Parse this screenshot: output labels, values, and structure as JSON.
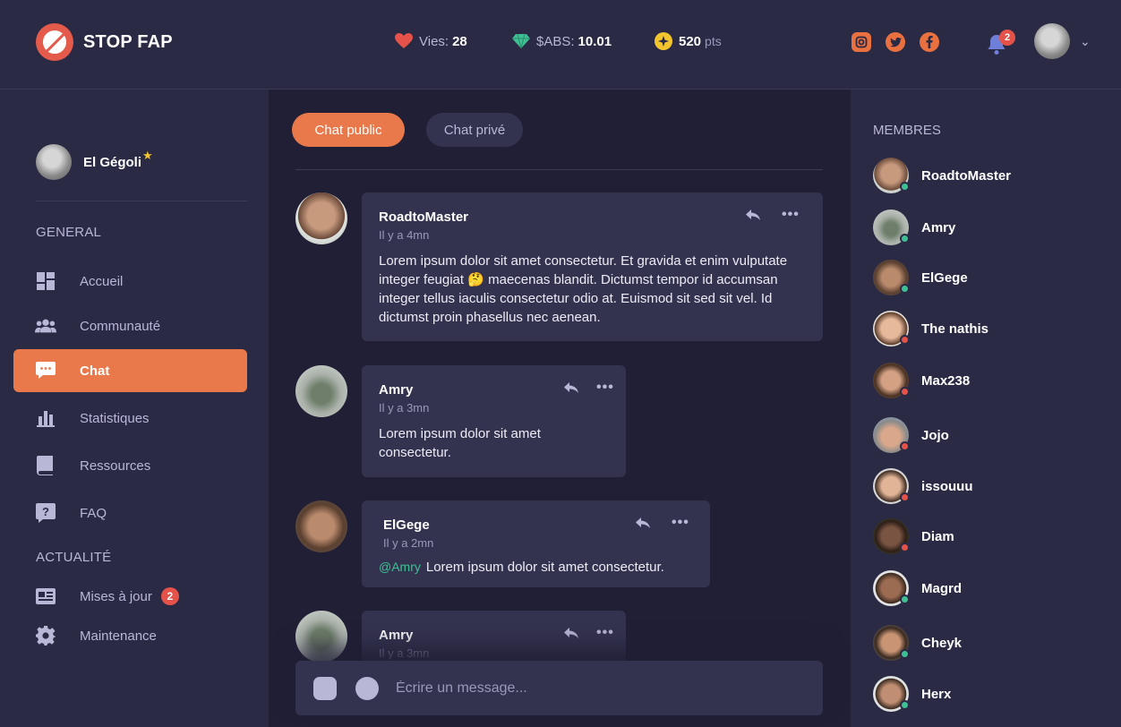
{
  "header": {
    "app_name": "STOP FAP",
    "lives_label": "Vies:",
    "lives_value": "28",
    "abs_label": "$ABS:",
    "abs_value": "10.01",
    "points_value": "520",
    "points_unit": "pts",
    "notifications_count": "2",
    "social": [
      "instagram-icon",
      "twitter-icon",
      "facebook-icon"
    ],
    "colors": {
      "accent": "#e9784a",
      "heart": "#e4524a",
      "gem": "#3fbf94",
      "coin": "#f2c52e"
    }
  },
  "sidebar": {
    "user_name": "El Gégoli",
    "section_general": "GENERAL",
    "section_news": "ACTUALITÉ",
    "items": [
      {
        "label": "Accueil",
        "icon": "dashboard-icon"
      },
      {
        "label": "Communauté",
        "icon": "users-icon"
      },
      {
        "label": "Chat",
        "icon": "chat-icon"
      },
      {
        "label": "Statistiques",
        "icon": "bar-chart-icon"
      },
      {
        "label": "Ressources",
        "icon": "book-icon"
      },
      {
        "label": "FAQ",
        "icon": "question-icon"
      }
    ],
    "news_items": [
      {
        "label": "Mises à jour",
        "badge": "2",
        "icon": "newspaper-icon"
      },
      {
        "label": "Maintenance",
        "icon": "gear-icon"
      }
    ]
  },
  "chat": {
    "tabs": [
      "Chat public",
      "Chat privé"
    ],
    "messages": [
      {
        "author": "RoadtoMaster",
        "time": "Il y a 4mn",
        "text_before": "Lorem ipsum dolor sit amet consectetur. Et gravida et enim vulputate integer feugiat",
        "emoji": "🤔",
        "text_after": "maecenas blandit. Dictumst tempor id accumsan integer tellus iaculis consectetur odio at. Euismod sit sed sit vel. Id dictumst proin phasellus nec aenean."
      },
      {
        "author": "Amry",
        "time": "Il y a 3mn",
        "text": "Lorem ipsum dolor sit amet consectetur."
      },
      {
        "author": "ElGege",
        "time": "Il y a 2mn",
        "mention": "@Amry",
        "text": "Lorem ipsum dolor sit amet consectetur."
      },
      {
        "author": "Amry",
        "time": "Il y a 3mn"
      }
    ],
    "composer_placeholder": "Écrire un message..."
  },
  "members": {
    "title": "MEMBRES",
    "list": [
      {
        "name": "RoadtoMaster",
        "status": "online"
      },
      {
        "name": "Amry",
        "status": "online"
      },
      {
        "name": "ElGege",
        "status": "online"
      },
      {
        "name": "The nathis",
        "status": "offline"
      },
      {
        "name": "Max238",
        "status": "offline"
      },
      {
        "name": "Jojo",
        "status": "offline"
      },
      {
        "name": "issouuu",
        "status": "offline"
      },
      {
        "name": "Diam",
        "status": "offline"
      },
      {
        "name": "Magrd",
        "status": "online"
      },
      {
        "name": "Cheyk",
        "status": "online"
      },
      {
        "name": "Herx",
        "status": "online"
      }
    ],
    "status_colors": {
      "online": "#3fbf94",
      "offline": "#e4524a"
    }
  }
}
